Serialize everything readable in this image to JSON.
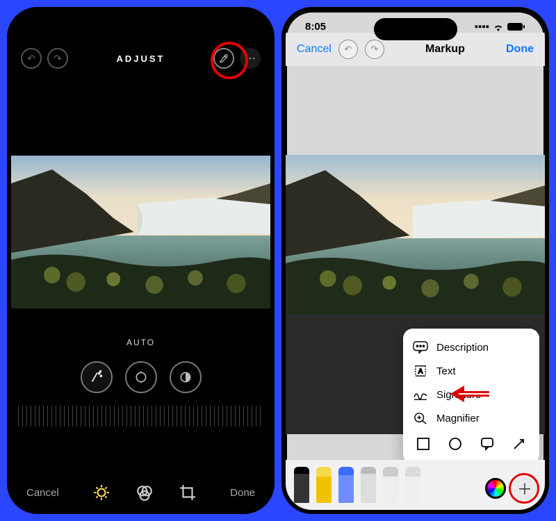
{
  "left": {
    "title": "ADJUST",
    "auto_label": "AUTO",
    "cancel": "Cancel",
    "done": "Done"
  },
  "right": {
    "time": "8:05",
    "cancel": "Cancel",
    "title": "Markup",
    "done": "Done",
    "menu": {
      "description": "Description",
      "text": "Text",
      "signature": "Signature",
      "magnifier": "Magnifier"
    }
  },
  "colors": {
    "highlight_ring": "#e40000",
    "ios_blue": "#0a7aff"
  }
}
